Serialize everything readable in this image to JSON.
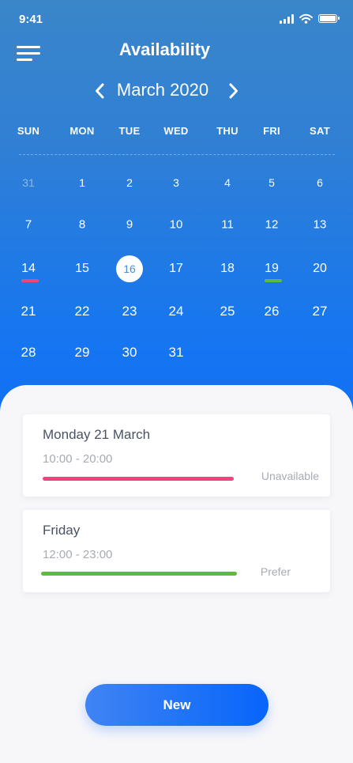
{
  "status_bar": {
    "time": "9:41",
    "icons": [
      "signal-icon",
      "wifi-icon",
      "battery-icon"
    ]
  },
  "header": {
    "title": "Availability",
    "menu_icon": "hamburger-menu-icon"
  },
  "calendar": {
    "month_label": "March 2020",
    "prev_icon": "chevron-left-icon",
    "next_icon": "chevron-right-icon",
    "weekdays": [
      "SUN",
      "MON",
      "TUE",
      "WED",
      "THU",
      "FRI",
      "SAT"
    ],
    "weeks": [
      [
        "31",
        "1",
        "2",
        "3",
        "4",
        "5",
        "6"
      ],
      [
        "7",
        "8",
        "9",
        "10",
        "11",
        "12",
        "13"
      ],
      [
        "14",
        "15",
        "16",
        "17",
        "18",
        "19",
        "20"
      ],
      [
        "21",
        "22",
        "23",
        "24",
        "25",
        "26",
        "27"
      ],
      [
        "28",
        "29",
        "30",
        "31",
        "",
        "",
        ""
      ]
    ],
    "previous_month_days": [
      "31"
    ],
    "selected_day": "16",
    "marked_days": [
      {
        "day": "14",
        "color": "#f0447e"
      },
      {
        "day": "19",
        "color": "#5dbb3f"
      }
    ]
  },
  "availability": [
    {
      "title": "Monday 21 March",
      "time": "10:00 - 20:00",
      "status": "Unavailable",
      "color": "#f0447e"
    },
    {
      "title": "Friday",
      "time": "12:00 - 23:00",
      "status": "Prefer",
      "color": "#5dbb3f"
    }
  ],
  "new_button": {
    "label": "New"
  },
  "colors": {
    "accent": "#1877ee",
    "unavailable": "#f0447e",
    "prefer": "#5dbb3f",
    "background": "#f7f7fa"
  }
}
